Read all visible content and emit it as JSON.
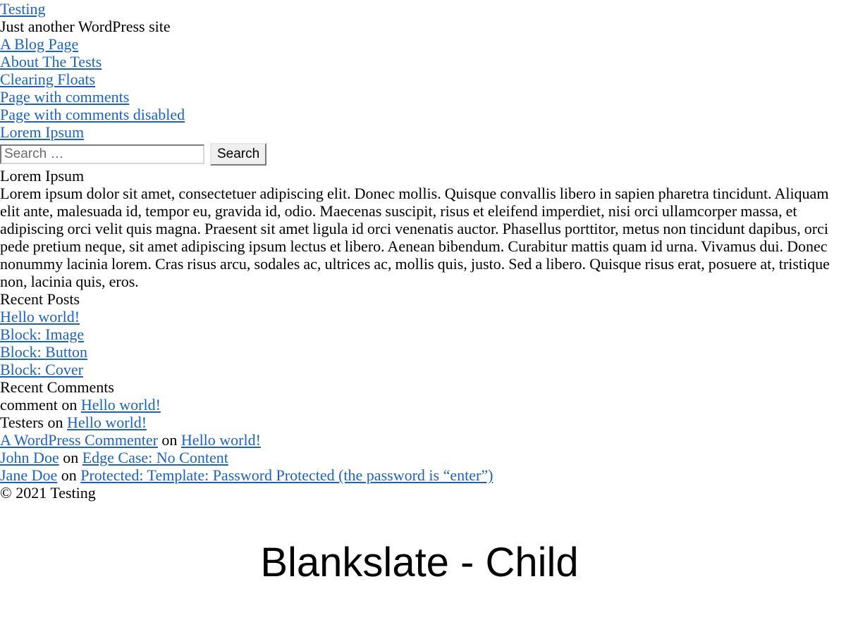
{
  "site": {
    "title": "Testing",
    "tagline": "Just another WordPress site"
  },
  "nav": {
    "items": [
      "A Blog Page",
      "About The Tests",
      "Clearing Floats",
      "Page with comments",
      "Page with comments disabled",
      "Lorem Ipsum"
    ]
  },
  "search": {
    "placeholder": "Search …",
    "value": "",
    "button_label": "Search"
  },
  "text_widget": {
    "title": "Lorem Ipsum",
    "body": "Lorem ipsum dolor sit amet, consectetuer adipiscing elit. Donec mollis. Quisque convallis libero in sapien pharetra tincidunt. Aliquam elit ante, malesuada id, tempor eu, gravida id, odio. Maecenas suscipit, risus et eleifend imperdiet, nisi orci ullamcorper massa, et adipiscing orci velit quis magna. Praesent sit amet ligula id orci venenatis auctor. Phasellus porttitor, metus non tincidunt dapibus, orci pede pretium neque, sit amet adipiscing ipsum lectus et libero. Aenean bibendum. Curabitur mattis quam id urna. Vivamus dui. Donec nonummy lacinia lorem. Cras risus arcu, sodales ac, ultrices ac, mollis quis, justo. Sed a libero. Quisque risus erat, posuere at, tristique non, lacinia quis, eros."
  },
  "recent_posts": {
    "title": "Recent Posts",
    "items": [
      "Hello world!",
      "Block: Image",
      "Block: Button",
      "Block: Cover"
    ]
  },
  "recent_comments": {
    "title": "Recent Comments",
    "connector": "on",
    "items": [
      {
        "author": "comment",
        "author_link": false,
        "post": "Hello world!"
      },
      {
        "author": "Testers",
        "author_link": false,
        "post": "Hello world!"
      },
      {
        "author": "A WordPress Commenter",
        "author_link": true,
        "post": "Hello world!"
      },
      {
        "author": "John Doe",
        "author_link": true,
        "post": "Edge Case: No Content"
      },
      {
        "author": "Jane Doe",
        "author_link": true,
        "post": "Protected: Template: Password Protected (the password is “enter”)"
      }
    ]
  },
  "footer": {
    "copyright": "© 2021 Testing"
  },
  "theme_label": "Blankslate - Child",
  "colors": {
    "link": "#1a63c6",
    "text": "#000000",
    "background": "#ffffff"
  }
}
